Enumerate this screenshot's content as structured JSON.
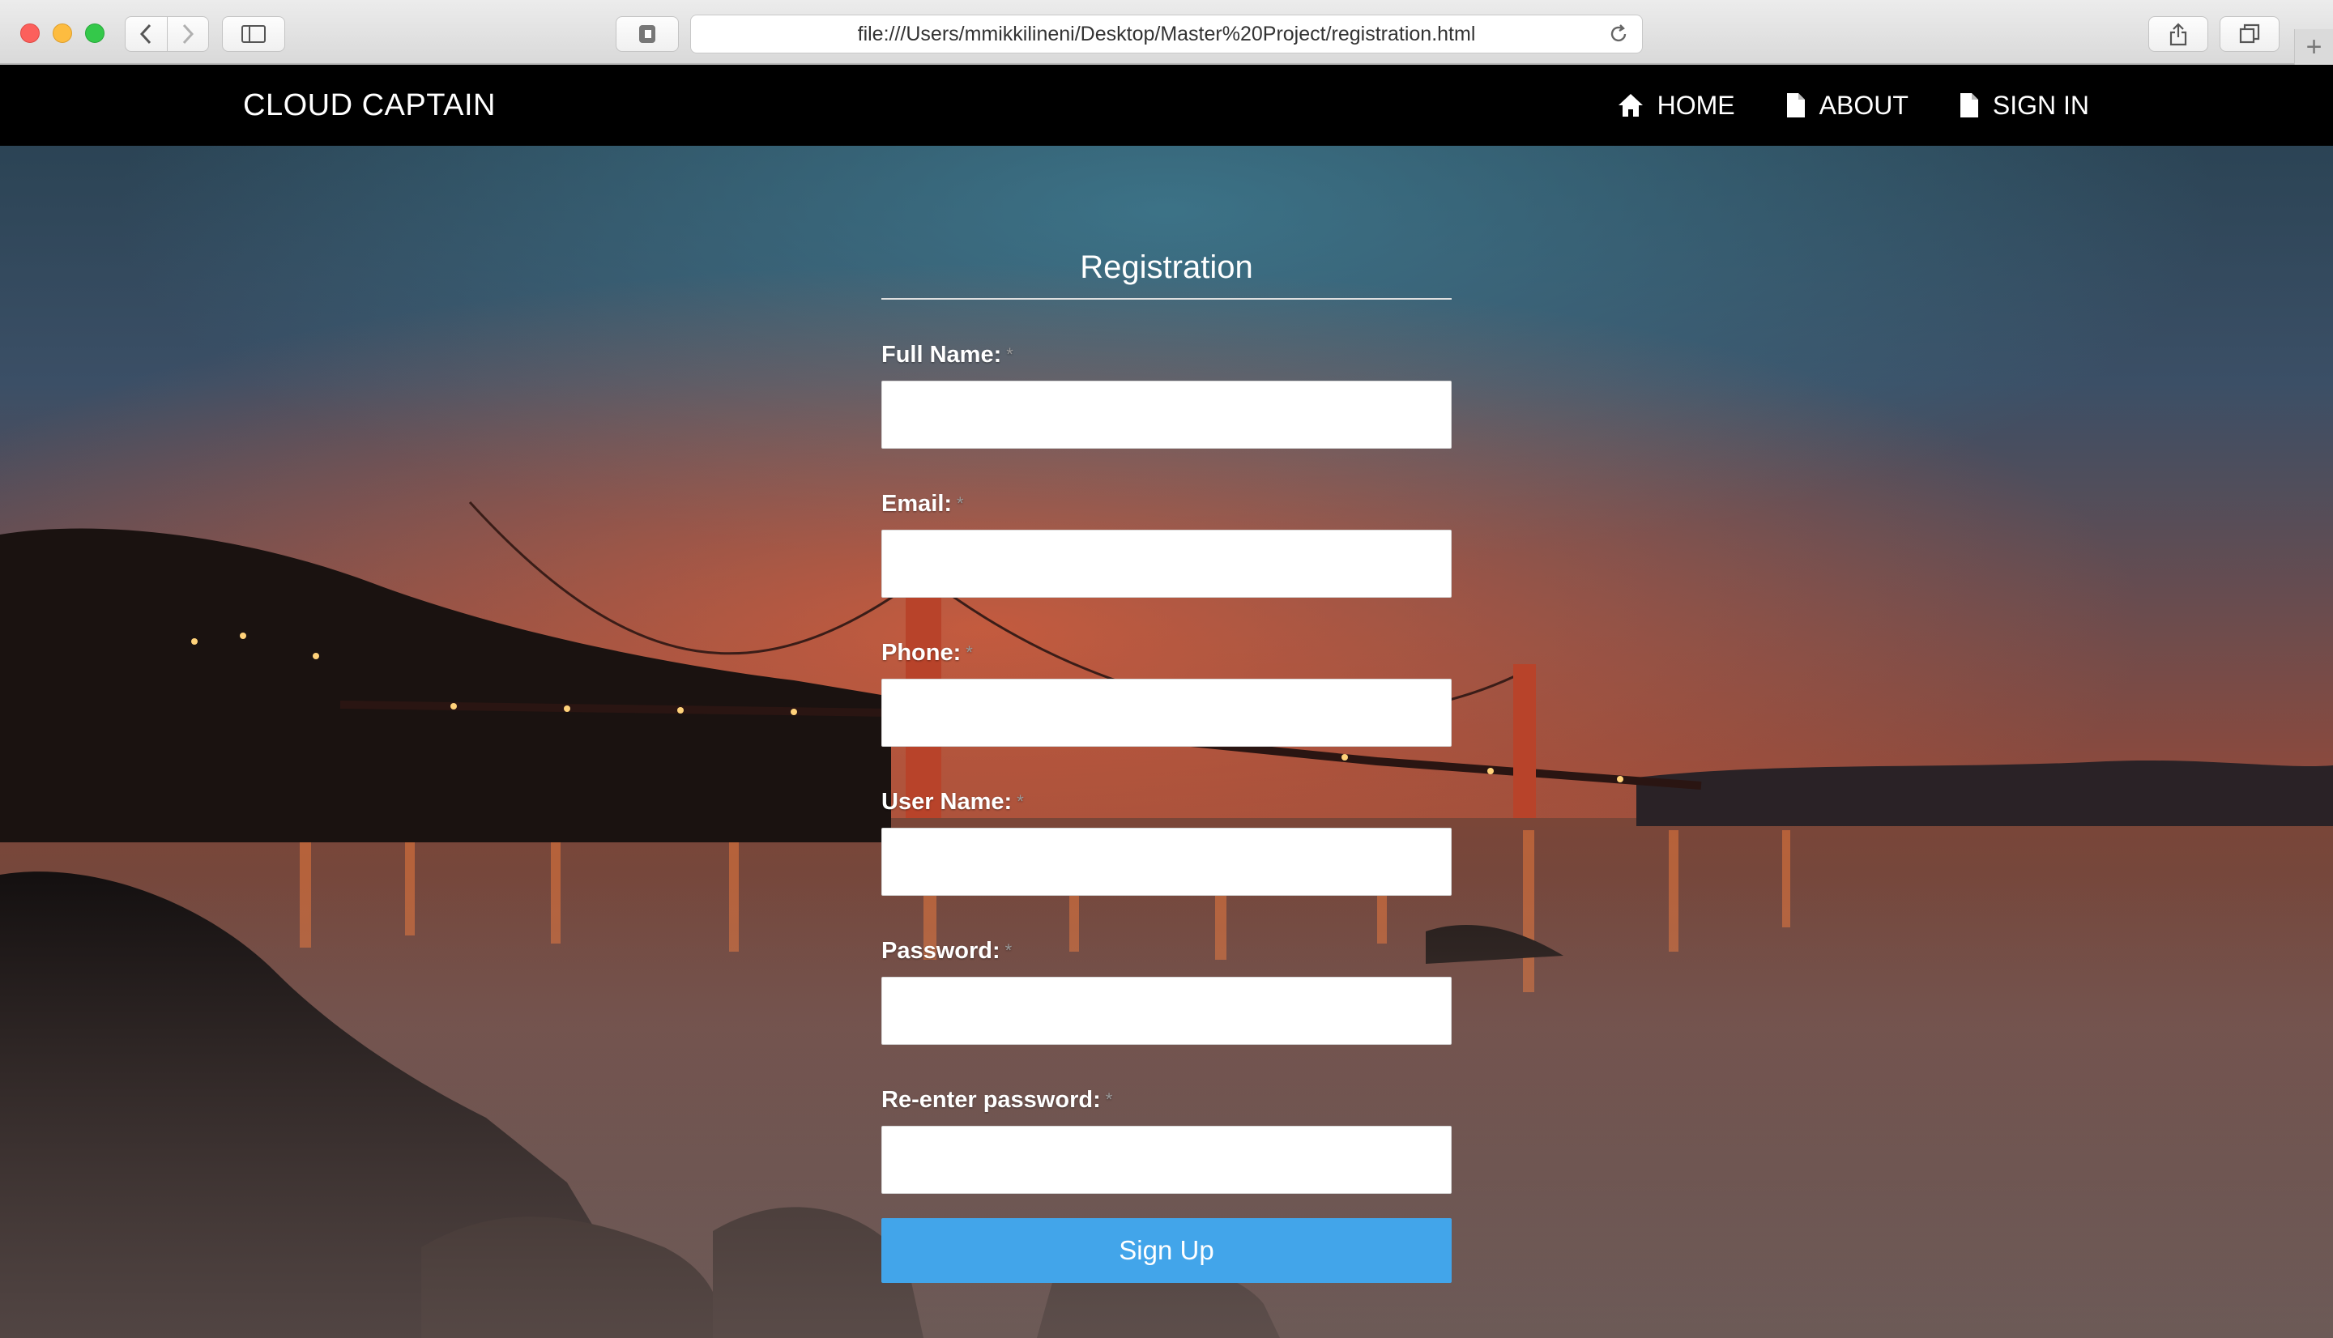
{
  "browser": {
    "address": "file:///Users/mmikkilineni/Desktop/Master%20Project/registration.html"
  },
  "navbar": {
    "brand": "CLOUD CAPTAIN",
    "links": [
      {
        "label": "HOME",
        "icon": "home-icon"
      },
      {
        "label": "ABOUT",
        "icon": "document-icon"
      },
      {
        "label": "SIGN IN",
        "icon": "document-icon"
      }
    ]
  },
  "form": {
    "title": "Registration",
    "required_marker": "*",
    "fields": [
      {
        "label": "Full Name:",
        "value": ""
      },
      {
        "label": "Email:",
        "value": ""
      },
      {
        "label": "Phone:",
        "value": ""
      },
      {
        "label": "User Name:",
        "value": ""
      },
      {
        "label": "Password:",
        "value": ""
      },
      {
        "label": "Re-enter password:",
        "value": ""
      }
    ],
    "submit_label": "Sign Up"
  },
  "colors": {
    "navbar": "#000000",
    "button": "#42a5ea"
  }
}
